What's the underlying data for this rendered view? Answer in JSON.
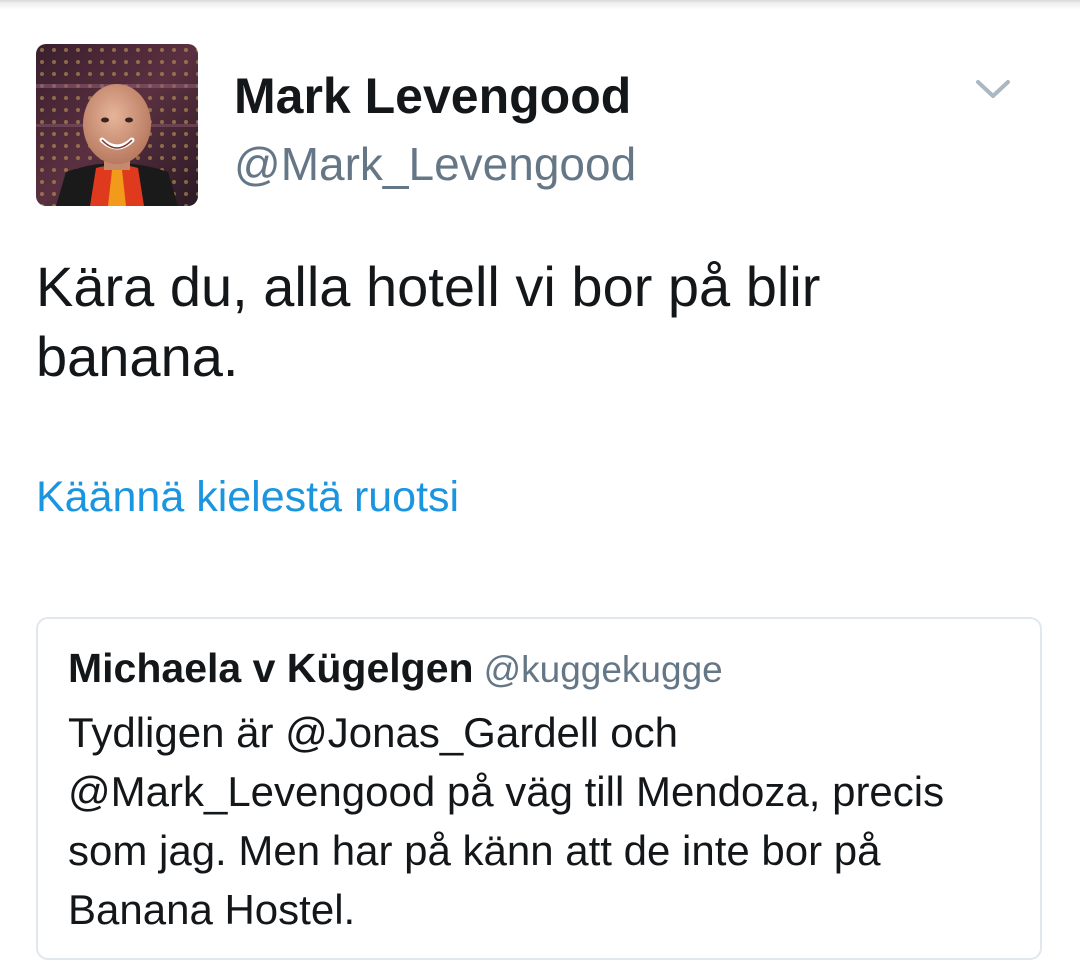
{
  "tweet": {
    "author": {
      "name": "Mark Levengood",
      "handle": "@Mark_Levengood"
    },
    "text": "Kära du, alla hotell vi bor på blir banana.",
    "translate_label": "Käännä kielestä ruotsi",
    "menu_icon": "chevron-down-icon"
  },
  "quoted_tweet": {
    "author": {
      "name": "Michaela v Kügelgen",
      "handle": "@kuggekugge"
    },
    "text": "Tydligen är @Jonas_Gardell och @Mark_Levengood på väg till Mendoza, precis som jag. Men har på känn att de inte bor på Banana Hostel."
  },
  "colors": {
    "text_primary": "#14171a",
    "text_secondary": "#657786",
    "link": "#1b95e0",
    "border": "#e1e8ed"
  }
}
